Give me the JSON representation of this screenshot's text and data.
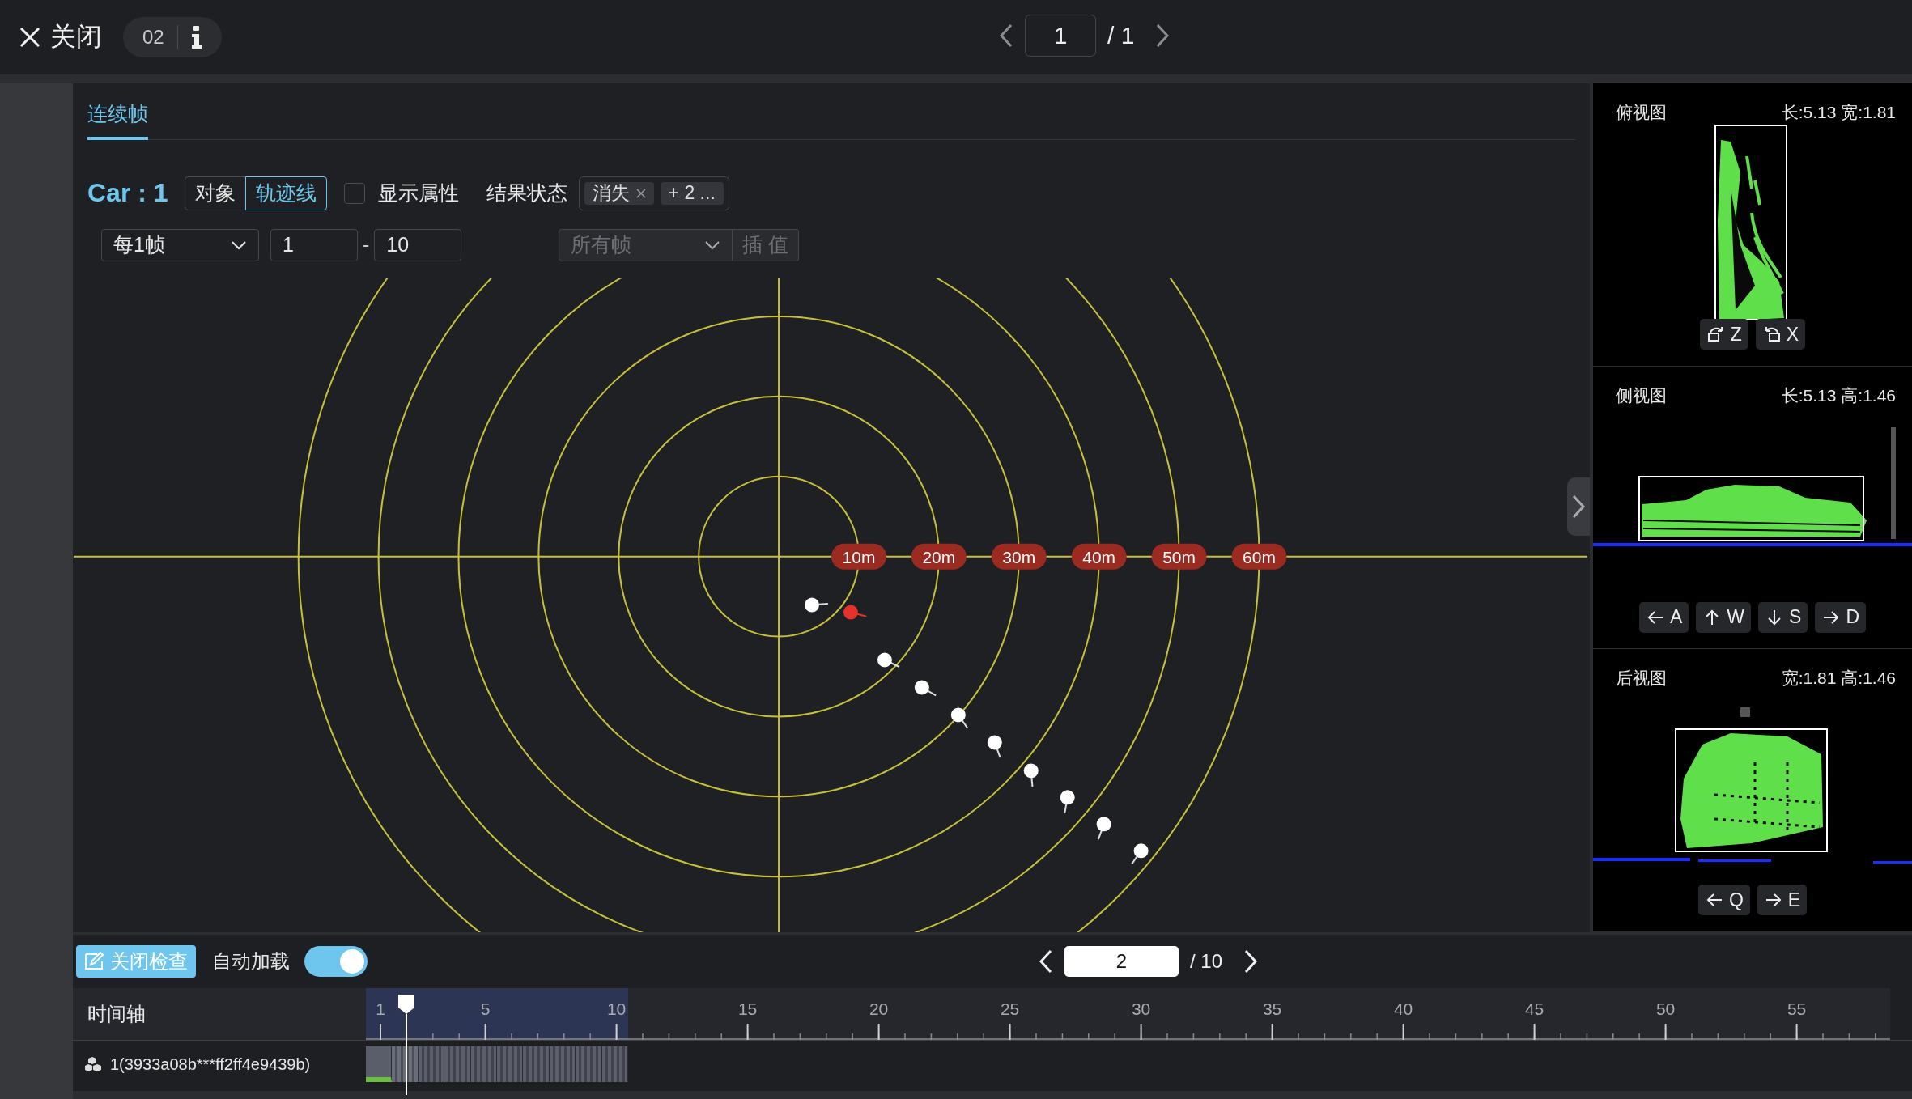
{
  "top_bar": {
    "close_button": "关闭",
    "frame_badge": "02",
    "pager": {
      "current": "1",
      "total": "/ 1"
    }
  },
  "editor": {
    "tabs": [
      {
        "label": "连续帧",
        "selected": true
      }
    ],
    "object_label": "Car : 1",
    "view_modes": [
      {
        "label": "对象",
        "selected": false
      },
      {
        "label": "轨迹线",
        "selected": true
      }
    ],
    "show_attributes": {
      "label": "显示属性",
      "checked": false
    },
    "result_status": {
      "label": "结果状态",
      "tags": [
        {
          "label": "消失",
          "kind": "removable"
        },
        {
          "label": "+ 2 ...",
          "kind": "more"
        }
      ]
    },
    "frame_step": "每1帧",
    "range_start": "1",
    "range_separator": "-",
    "range_end": "10",
    "frame_filter": {
      "value": "所有帧",
      "disabled": true
    },
    "interpolate_button": {
      "label": "插 值",
      "disabled": true
    },
    "radar": {
      "ring_labels": [
        "10m",
        "20m",
        "30m",
        "40m",
        "50m",
        "60m"
      ],
      "track_points": [
        {
          "selected": false
        },
        {
          "selected": true
        },
        {
          "selected": false
        },
        {
          "selected": false
        },
        {
          "selected": false
        },
        {
          "selected": false
        },
        {
          "selected": false
        },
        {
          "selected": false
        },
        {
          "selected": false
        },
        {
          "selected": false
        }
      ]
    }
  },
  "views": [
    {
      "kind": "top",
      "title": "俯视图",
      "dimensions": "长:5.13 宽:1.81",
      "controls": [
        {
          "kind": "rotate-left",
          "key": "Z"
        },
        {
          "kind": "rotate-right",
          "key": "X"
        }
      ]
    },
    {
      "kind": "side",
      "title": "侧视图",
      "dimensions": "长:5.13 高:1.46",
      "controls": [
        {
          "kind": "left",
          "key": "A"
        },
        {
          "kind": "up",
          "key": "W"
        },
        {
          "kind": "down",
          "key": "S"
        },
        {
          "kind": "right",
          "key": "D"
        }
      ]
    },
    {
      "kind": "rear",
      "title": "后视图",
      "dimensions": "宽:1.81 高:1.46",
      "controls": [
        {
          "kind": "left",
          "key": "Q"
        },
        {
          "kind": "right",
          "key": "E"
        }
      ]
    }
  ],
  "bottom": {
    "close_check_button": "关闭检查",
    "auto_load": {
      "label": "自动加载",
      "on": true
    },
    "pager": {
      "current": "2",
      "total": "/ 10"
    },
    "timeline": {
      "label": "时间轴",
      "ticks": [
        "1",
        "5",
        "10",
        "15",
        "20",
        "25",
        "30",
        "35",
        "40",
        "45",
        "50",
        "55"
      ],
      "tracks": [
        {
          "label": "1(3933a08b***ff2ff4e9439b)",
          "frames": [
            {
              "selected": false,
              "marked": true
            },
            {
              "selected": true,
              "marked": false
            },
            {
              "selected": false,
              "marked": false
            },
            {
              "selected": false,
              "marked": false
            },
            {
              "selected": false,
              "marked": false
            },
            {
              "selected": false,
              "marked": false
            },
            {
              "selected": false,
              "marked": false
            },
            {
              "selected": false,
              "marked": false
            },
            {
              "selected": false,
              "marked": false
            },
            {
              "selected": false,
              "marked": false
            }
          ]
        }
      ]
    }
  }
}
